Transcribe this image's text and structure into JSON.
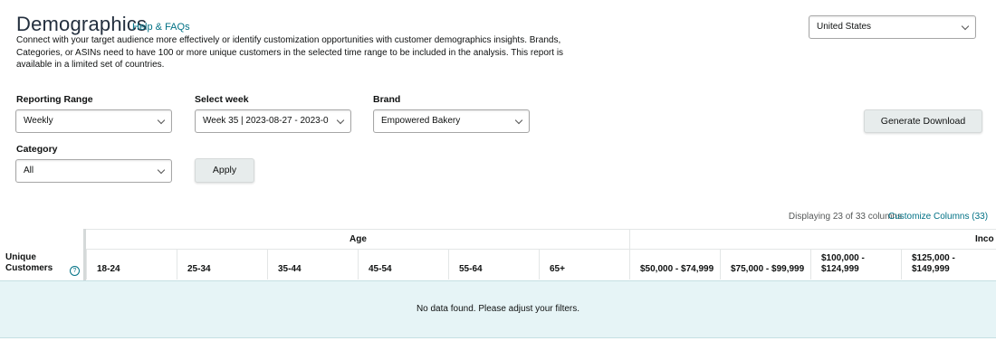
{
  "header": {
    "title": "Demographics",
    "help_link": "Help & FAQs",
    "description": "Connect with your target audience more effectively or identify customization opportunities with customer demographics insights. Brands, Categories, or ASINs need to have 100 or more unique customers in the selected time range to be included in the analysis. This report is available in a limited set of countries."
  },
  "country_select": {
    "value": "United States"
  },
  "filters": {
    "reporting_range": {
      "label": "Reporting Range",
      "value": "Weekly"
    },
    "select_week": {
      "label": "Select week",
      "value": "Week 35 | 2023-08-27 - 2023-0"
    },
    "brand": {
      "label": "Brand",
      "value": "Empowered Bakery"
    },
    "category": {
      "label": "Category",
      "value": "All"
    },
    "apply_label": "Apply",
    "generate_download_label": "Generate Download"
  },
  "table_info": {
    "displaying": "Displaying 23 of 33 columns",
    "customize": "Customize Columns (33)"
  },
  "table": {
    "sticky_header": "Unique Customers",
    "groups": {
      "age": "Age",
      "income": "Inco"
    },
    "age_columns": [
      "18-24",
      "25-34",
      "35-44",
      "45-54",
      "55-64",
      "65+"
    ],
    "income_columns": [
      "$50,000 - $74,999",
      "$75,000 - $99,999",
      "$100,000 - $124,999",
      "$125,000 - $149,999"
    ],
    "empty_message": "No data found. Please adjust your filters."
  },
  "colors": {
    "link": "#007185",
    "empty_band": "#e6f4f6",
    "title": "#232f3e"
  }
}
